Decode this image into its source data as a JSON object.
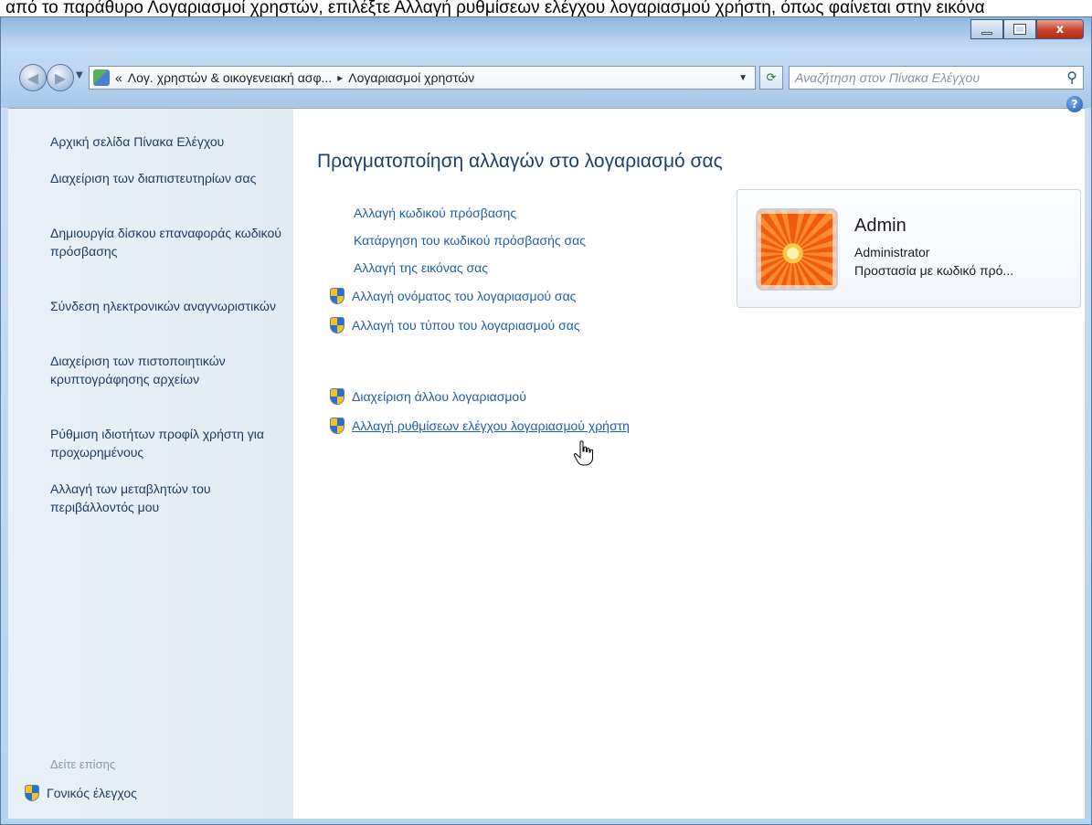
{
  "top_caption": "από το παράθυρο Λογαριασμοί χρηστών, επιλέξτε Αλλαγή ρυθμίσεων ελέγχου λογαριασμού χρήστη, όπως φαίνεται στην εικόνα",
  "window": {
    "caption_buttons": {
      "minimize": "minimize-icon",
      "maximize": "maximize-icon",
      "close": "close-icon",
      "close_glyph": "x"
    }
  },
  "navbar": {
    "breadcrumb_prefix": "«",
    "breadcrumb_parent": "Λογ. χρηστών & οικογενειακή ασφ...",
    "breadcrumb_separator": "▸",
    "breadcrumb_current": "Λογαριασμοί χρηστών",
    "search_placeholder": "Αναζήτηση στον Πίνακα Ελέγχου"
  },
  "sidebar": {
    "items": [
      {
        "label": "Αρχική σελίδα Πίνακα Ελέγχου"
      },
      {
        "label": "Διαχείριση των διαπιστευτηρίων σας"
      },
      {
        "label": "Δημιουργία δίσκου επαναφοράς κωδικού πρόσβασης"
      },
      {
        "label": "Σύνδεση ηλεκτρονικών αναγνωριστικών"
      },
      {
        "label": "Διαχείριση των πιστοποιητικών κρυπτογράφησης αρχείων"
      },
      {
        "label": "Ρύθμιση ιδιοτήτων προφίλ χρήστη για προχωρημένους"
      },
      {
        "label": "Αλλαγή των μεταβλητών του περιβάλλοντός μου"
      }
    ],
    "see_also": "Δείτε επίσης",
    "parental_controls": "Γονικός έλεγχος"
  },
  "main": {
    "title": "Πραγματοποίηση αλλαγών στο λογαριασμό σας",
    "tasks": [
      {
        "label": "Αλλαγή κωδικού πρόσβασης",
        "shield": false
      },
      {
        "label": "Κατάργηση του κωδικού πρόσβασής σας",
        "shield": false
      },
      {
        "label": "Αλλαγή της εικόνας σας",
        "shield": false
      },
      {
        "label": "Αλλαγή ονόματος του λογαριασμού σας",
        "shield": true
      },
      {
        "label": "Αλλαγή του τύπου του λογαριασμού σας",
        "shield": true
      }
    ],
    "other_tasks": [
      {
        "label": "Διαχείριση άλλου λογαριασμού",
        "shield": true
      },
      {
        "label": "Αλλαγή ρυθμίσεων ελέγχου λογαριασμού χρήστη",
        "shield": true,
        "hovered": true
      }
    ],
    "help_glyph": "?"
  },
  "user_card": {
    "name": "Admin",
    "role": "Administrator",
    "status": "Προστασία με κωδικό πρό..."
  },
  "colors": {
    "link": "#1c5eb0",
    "sidebar_link": "#1e3a5e",
    "title": "#1e3e6e",
    "sidebar_bg": "#e6eef6"
  }
}
